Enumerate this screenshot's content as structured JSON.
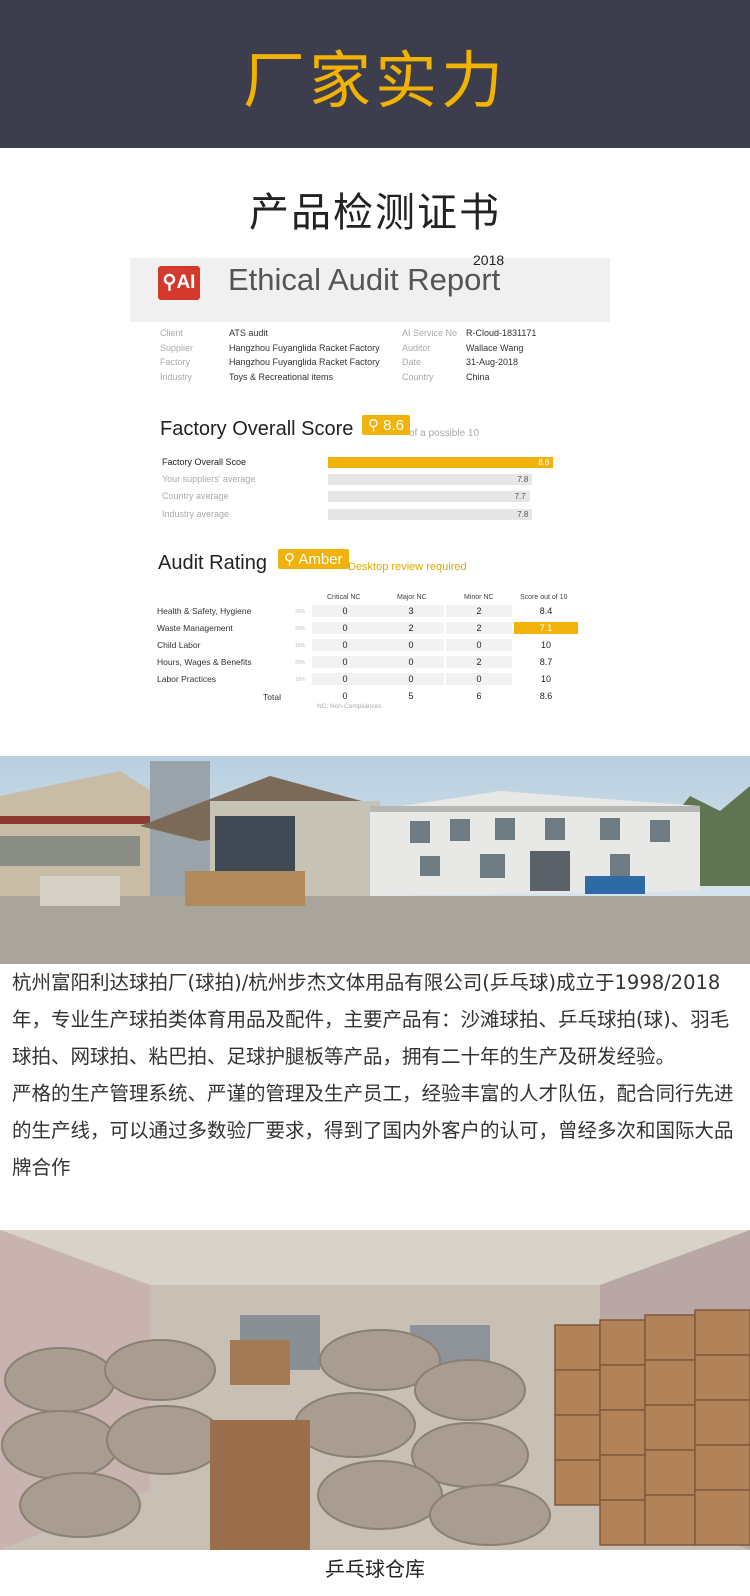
{
  "banner": {
    "title": "厂家实力"
  },
  "section": {
    "title": "产品检测证书"
  },
  "report": {
    "logo": "⚲AI",
    "title": "Ethical Audit Report",
    "year": "2018",
    "meta_left": [
      {
        "k": "Client",
        "v": "ATS audit"
      },
      {
        "k": "Supplier",
        "v": "Hangzhou Fuyanglida Racket Factory"
      },
      {
        "k": "Factory",
        "v": "Hangzhou Fuyanglida Racket Factory"
      },
      {
        "k": "Industry",
        "v": "Toys & Recreational items"
      }
    ],
    "meta_right": [
      {
        "k": "AI Service No",
        "v": "R-Cloud-1831171"
      },
      {
        "k": "Auditor",
        "v": "Wallace Wang"
      },
      {
        "k": "Date",
        "v": "31-Aug-2018"
      },
      {
        "k": "Country",
        "v": "China"
      }
    ],
    "overall": {
      "title": "Factory Overall Score",
      "badge": "⚲ 8.6",
      "note": "of a possible 10",
      "max": 10,
      "bars": [
        {
          "label": "Factory Overall Scoe",
          "value": 8.6,
          "display": "8.6",
          "main": true
        },
        {
          "label": "Your suppliers' average",
          "value": 7.8,
          "display": "7.8",
          "main": false
        },
        {
          "label": "Country average",
          "value": 7.7,
          "display": "7.7",
          "main": false
        },
        {
          "label": "Industry average",
          "value": 7.8,
          "display": "7.8",
          "main": false
        }
      ]
    },
    "rating": {
      "title": "Audit Rating",
      "badge": "⚲ Amber",
      "note": "Desktop review required",
      "headers": [
        "Critical NC",
        "Major NC",
        "Minor NC",
        "Score out of 10"
      ],
      "rows": [
        {
          "label": "Health & Safety, Hygiene",
          "weight": "25%",
          "critical": "0",
          "major": "3",
          "minor": "2",
          "score": "8.4",
          "flag": false
        },
        {
          "label": "Waste Management",
          "weight": "20%",
          "critical": "0",
          "major": "2",
          "minor": "2",
          "score": "7.1",
          "flag": true
        },
        {
          "label": "Child Labor",
          "weight": "15%",
          "critical": "0",
          "major": "0",
          "minor": "0",
          "score": "10",
          "flag": false
        },
        {
          "label": "Hours, Wages & Benefits",
          "weight": "20%",
          "critical": "0",
          "major": "0",
          "minor": "2",
          "score": "8.7",
          "flag": false
        },
        {
          "label": "Labor Practices",
          "weight": "10%",
          "critical": "0",
          "major": "0",
          "minor": "0",
          "score": "10",
          "flag": false
        }
      ],
      "total": {
        "label": "Total",
        "critical": "0",
        "major": "5",
        "minor": "6",
        "score": "8.6"
      },
      "footnote": "NC: Non-Compliances"
    }
  },
  "description": {
    "p1": "杭州富阳利达球拍厂(球拍)/杭州步杰文体用品有限公司(乒乓球)成立于1998/2018年，专业生产球拍类体育用品及配件，主要产品有：沙滩球拍、乒乓球拍(球)、羽毛球拍、网球拍、粘巴拍、足球护腿板等产品，拥有二十年的生产及研发经验。",
    "p2": "严格的生产管理系统、严谨的管理及生产员工，经验丰富的人才队伍，配合同行先进的生产线，可以通过多数验厂要求，得到了国内外客户的认可，曾经多次和国际大品牌合作"
  },
  "warehouse": {
    "caption": "乒乓球仓库"
  }
}
